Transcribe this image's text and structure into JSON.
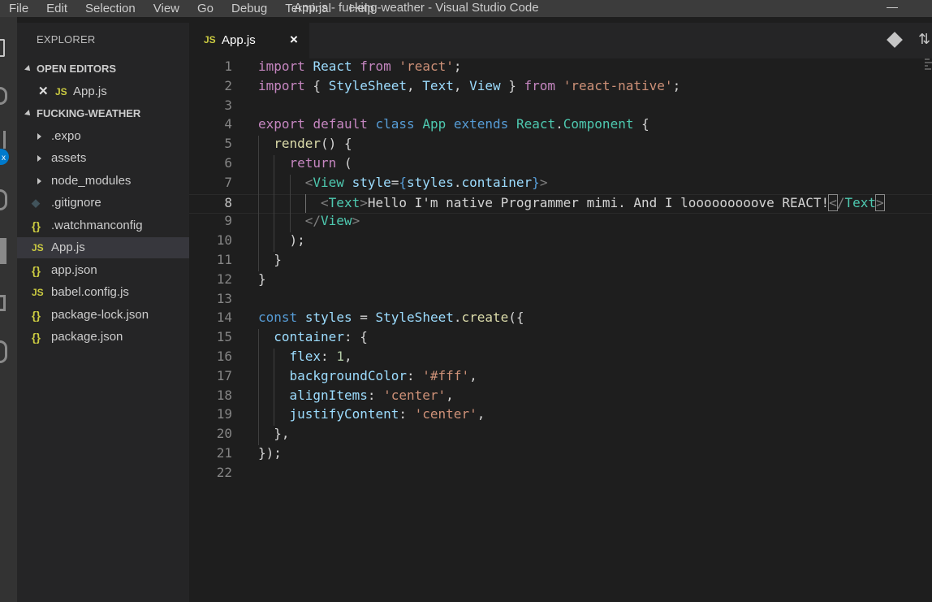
{
  "menu": [
    "File",
    "Edit",
    "Selection",
    "View",
    "Go",
    "Debug",
    "Terminal",
    "Help"
  ],
  "window_title": "App.js - fucking-weather - Visual Studio Code",
  "activity_badge": "x",
  "explorer": {
    "title": "EXPLORER",
    "open_editors_label": "OPEN EDITORS",
    "open_editors": [
      {
        "icon": "JS",
        "name": "App.js"
      }
    ],
    "project_label": "FUCKING-WEATHER",
    "items": [
      {
        "icon": "folder-arrow",
        "name": ".expo"
      },
      {
        "icon": "folder-arrow",
        "name": "assets"
      },
      {
        "icon": "folder-arrow",
        "name": "node_modules"
      },
      {
        "icon": "git-icon",
        "name": ".gitignore"
      },
      {
        "icon": "{}",
        "name": ".watchmanconfig"
      },
      {
        "icon": "JS",
        "name": "App.js",
        "active": true
      },
      {
        "icon": "{}",
        "name": "app.json"
      },
      {
        "icon": "JS",
        "name": "babel.config.js"
      },
      {
        "icon": "{}",
        "name": "package-lock.json"
      },
      {
        "icon": "{}",
        "name": "package.json"
      }
    ]
  },
  "tab": {
    "icon": "JS",
    "label": "App.js",
    "close": "×"
  },
  "editor": {
    "current_line": 8,
    "lines": [
      "1",
      "2",
      "3",
      "4",
      "5",
      "6",
      "7",
      "8",
      "9",
      "10",
      "11",
      "12",
      "13",
      "14",
      "15",
      "16",
      "17",
      "18",
      "19",
      "20",
      "21",
      "22"
    ],
    "code": {
      "l1": [
        "import",
        " ",
        "React",
        " ",
        "from",
        " ",
        "'react'",
        ";"
      ],
      "l2": [
        "import",
        " { ",
        "StyleSheet",
        ", ",
        "Text",
        ", ",
        "View",
        " } ",
        "from",
        " ",
        "'react-native'",
        ";"
      ],
      "l4": [
        "export",
        " ",
        "default",
        " ",
        "class",
        " ",
        "App",
        " ",
        "extends",
        " ",
        "React",
        ".",
        "Component",
        " {"
      ],
      "l5": [
        "render",
        "() {"
      ],
      "l6": [
        "return",
        " ("
      ],
      "l7": [
        "<",
        "View",
        " ",
        "style",
        "=",
        "{",
        "styles",
        ".",
        "container",
        "}",
        ">"
      ],
      "l8": [
        "<",
        "Text",
        ">",
        "Hello I'm native Programmer mimi. And I looooooooove REACT!",
        "<",
        "/",
        "Text",
        ">"
      ],
      "l9": [
        "</",
        "View",
        ">"
      ],
      "l10": [
        ");"
      ],
      "l11": [
        "}"
      ],
      "l12": [
        "}"
      ],
      "l14": [
        "const",
        " ",
        "styles",
        " = ",
        "StyleSheet",
        ".",
        "create",
        "({"
      ],
      "l15": [
        "container",
        ": {"
      ],
      "l16": [
        "flex",
        ": ",
        "1",
        ","
      ],
      "l17": [
        "backgroundColor",
        ": ",
        "'#fff'",
        ","
      ],
      "l18": [
        "alignItems",
        ": ",
        "'center'",
        ","
      ],
      "l19": [
        "justifyContent",
        ": ",
        "'center'",
        ","
      ],
      "l20": [
        "},"
      ],
      "l21": [
        "});"
      ]
    }
  },
  "colors": {
    "keyword": "#c586c0",
    "storage": "#569cd6",
    "variable": "#9cdcfe",
    "class": "#4ec9b0",
    "string": "#ce9178",
    "function": "#dcdcaa",
    "number": "#b5cea8"
  }
}
